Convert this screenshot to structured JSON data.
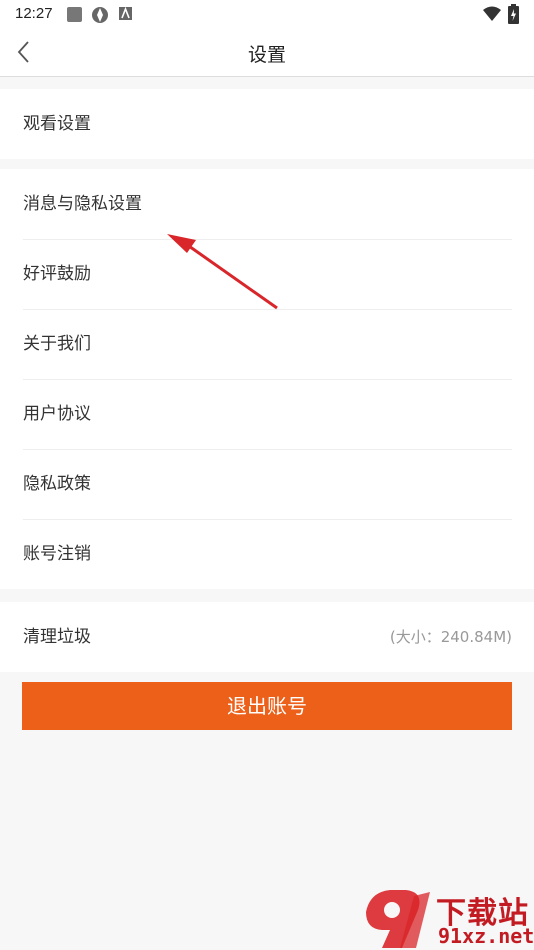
{
  "status": {
    "time": "12:27"
  },
  "header": {
    "title": "设置"
  },
  "groups": {
    "watch": [
      "观看设置"
    ],
    "main": [
      "消息与隐私设置",
      "好评鼓励",
      "关于我们",
      "用户协议",
      "隐私政策",
      "账号注销"
    ],
    "cache": {
      "label": "清理垃圾",
      "value": "(大小：240.84M)"
    }
  },
  "logout": {
    "label": "退出账号"
  },
  "watermark": {
    "brand": "下载站",
    "domain": "91xz.net"
  },
  "colors": {
    "accent": "#ec601a",
    "annotation": "#d9262a"
  }
}
